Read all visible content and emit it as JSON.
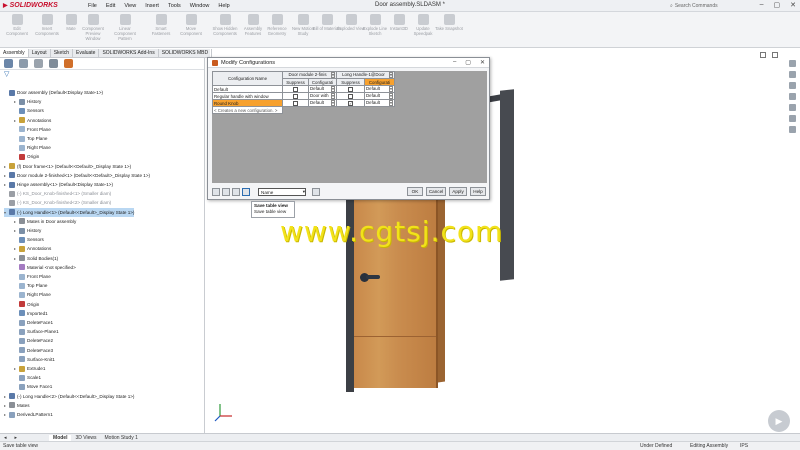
{
  "app": {
    "brand": "SOLIDWORKS",
    "document_title": "Door assembly.SLDASM *",
    "menu": [
      "File",
      "Edit",
      "View",
      "Insert",
      "Tools",
      "Window",
      "Help"
    ],
    "search_placeholder": "Search Commands"
  },
  "ribbon": {
    "buttons": [
      "Edit Component",
      "Insert Components",
      "Mate",
      "Component Preview Window",
      "Linear Component Pattern",
      "Smart Fasteners",
      "Move Component",
      "Show Hidden Components",
      "Assembly Features",
      "Reference Geometry",
      "New Motion Study",
      "Bill of Materials",
      "Exploded View",
      "Explode Line Sketch",
      "Instant3D",
      "Update Speedpak",
      "Take Snapshot"
    ]
  },
  "command_tabs": [
    "Assembly",
    "Layout",
    "Sketch",
    "Evaluate",
    "SOLIDWORKS Add-Ins",
    "SOLIDWORKS MBD"
  ],
  "tree": {
    "items": [
      {
        "label": "Door assembly (Default<Display State-1>)",
        "indent": 0,
        "exp": "",
        "color": "#5a79a8"
      },
      {
        "label": "History",
        "indent": 1,
        "exp": "▸",
        "color": "#7b8fa6"
      },
      {
        "label": "Sensors",
        "indent": 1,
        "exp": "",
        "color": "#6c8fb9"
      },
      {
        "label": "Annotations",
        "indent": 1,
        "exp": "▸",
        "color": "#c8a23a"
      },
      {
        "label": "Front Plane",
        "indent": 1,
        "exp": "",
        "color": "#9bb4cf"
      },
      {
        "label": "Top Plane",
        "indent": 1,
        "exp": "",
        "color": "#9bb4cf"
      },
      {
        "label": "Right Plane",
        "indent": 1,
        "exp": "",
        "color": "#9bb4cf"
      },
      {
        "label": "Origin",
        "indent": 1,
        "exp": "",
        "color": "#c23b3b"
      },
      {
        "label": "(f) Door frame<1> (Default<<Default>_Display State 1>)",
        "indent": 0,
        "exp": "▸",
        "color": "#c8a23a"
      },
      {
        "label": "Door module 2-finished<1> (Default<<Default>_Display State 1>)",
        "indent": 0,
        "exp": "▸",
        "color": "#5a79a8"
      },
      {
        "label": "Hinge assembly<1> (Default<Display State-1>)",
        "indent": 0,
        "exp": "▸",
        "color": "#5a79a8"
      },
      {
        "label": "(-) KS_Door_Knob-finished<1> (Smaller diam)",
        "indent": 0,
        "exp": "",
        "color": "#9a9ea5",
        "grey": true
      },
      {
        "label": "(-) KS_Door_Knob-finished<2> (Smaller diam)",
        "indent": 0,
        "exp": "",
        "color": "#9a9ea5",
        "grey": true
      },
      {
        "label": "(-) Long Handle<1> (Default<<Default>_Display State 1>)",
        "indent": 0,
        "exp": "▾",
        "color": "#5a79a8",
        "sel": true
      },
      {
        "label": "Mates in Door assembly",
        "indent": 1,
        "exp": "▸",
        "color": "#8a8f96"
      },
      {
        "label": "History",
        "indent": 1,
        "exp": "▸",
        "color": "#7b8fa6"
      },
      {
        "label": "Sensors",
        "indent": 1,
        "exp": "",
        "color": "#6c8fb9"
      },
      {
        "label": "Annotations",
        "indent": 1,
        "exp": "▸",
        "color": "#c8a23a"
      },
      {
        "label": "Solid Bodies(1)",
        "indent": 1,
        "exp": "▸",
        "color": "#8a8f96"
      },
      {
        "label": "Material <not specified>",
        "indent": 1,
        "exp": "",
        "color": "#a47bc2"
      },
      {
        "label": "Front Plane",
        "indent": 1,
        "exp": "",
        "color": "#9bb4cf"
      },
      {
        "label": "Top Plane",
        "indent": 1,
        "exp": "",
        "color": "#9bb4cf"
      },
      {
        "label": "Right Plane",
        "indent": 1,
        "exp": "",
        "color": "#9bb4cf"
      },
      {
        "label": "Origin",
        "indent": 1,
        "exp": "",
        "color": "#c23b3b"
      },
      {
        "label": "Imported1",
        "indent": 1,
        "exp": "",
        "color": "#6c8fb9"
      },
      {
        "label": "DeleteFace1",
        "indent": 1,
        "exp": "",
        "color": "#8aa1bd"
      },
      {
        "label": "Surface-Plane1",
        "indent": 1,
        "exp": "",
        "color": "#8aa1bd"
      },
      {
        "label": "DeleteFace2",
        "indent": 1,
        "exp": "",
        "color": "#8aa1bd"
      },
      {
        "label": "DeleteFace3",
        "indent": 1,
        "exp": "",
        "color": "#8aa1bd"
      },
      {
        "label": "Surface-Knit1",
        "indent": 1,
        "exp": "",
        "color": "#8aa1bd"
      },
      {
        "label": "Extrude1",
        "indent": 1,
        "exp": "▸",
        "color": "#c8a23a"
      },
      {
        "label": "Scale1",
        "indent": 1,
        "exp": "",
        "color": "#8aa1bd"
      },
      {
        "label": "Move Face1",
        "indent": 1,
        "exp": "",
        "color": "#8aa1bd"
      },
      {
        "label": "(-) Long Handle<2> (Default<<Default>_Display State 1>)",
        "indent": 0,
        "exp": "▸",
        "color": "#5a79a8"
      },
      {
        "label": "Mates",
        "indent": 0,
        "exp": "▸",
        "color": "#8a8f96"
      },
      {
        "label": "DerivedLPattern1",
        "indent": 0,
        "exp": "▸",
        "color": "#8aa1bd"
      }
    ]
  },
  "bottom_tabs": [
    "Model",
    "3D Views",
    "Motion Study 1"
  ],
  "status": {
    "left": "Save table view",
    "right1": "Under Defined",
    "right2": "Editing Assembly",
    "right3": "IPS"
  },
  "dialog": {
    "title": "Modify Configurations",
    "col_header_config": "Configuration Name",
    "group1": "Door module 2-finis",
    "group2": "Long Handle-1@Door",
    "sub_suppress": "Suppress",
    "sub_config": "Configurati",
    "rows": [
      {
        "name": "Default",
        "s1": false,
        "c1": "Default",
        "s2": false,
        "c2": "Default"
      },
      {
        "name": "Regular handle with window",
        "s1": false,
        "c1": "Door with",
        "s2": false,
        "c2": "Default"
      },
      {
        "name": "Round Knob",
        "s1": false,
        "c1": "Default",
        "s2": true,
        "c2": "Default"
      }
    ],
    "new_config_placeholder": "< Creates a new configuration. >",
    "name_select": "Name",
    "ok": "OK",
    "cancel": "Cancel",
    "apply": "Apply",
    "help": "Help"
  },
  "tooltip": {
    "title": "Save table view",
    "body": "Save table view"
  },
  "watermark": "www.cgtsj.com"
}
